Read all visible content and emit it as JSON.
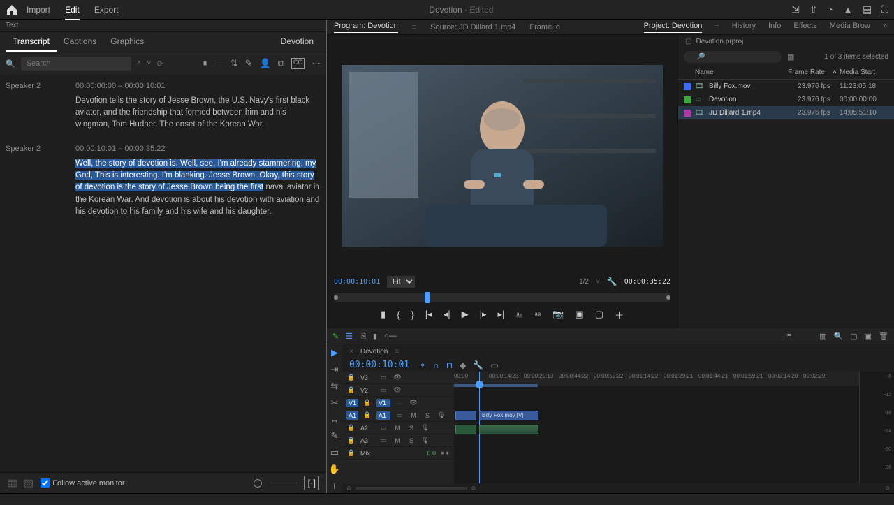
{
  "app": {
    "modes": [
      "Import",
      "Edit",
      "Export"
    ],
    "active_mode": "Edit",
    "title": "Devotion",
    "title_suffix": "Edited"
  },
  "left": {
    "text_tab": "Text",
    "sub_tabs": [
      "Transcript",
      "Captions",
      "Graphics"
    ],
    "active_sub": "Transcript",
    "sequence": "Devotion",
    "search_placeholder": "Search",
    "segments": [
      {
        "speaker": "Speaker 2",
        "tc": "00:00:00:00 – 00:00:10:01",
        "text": "Devotion tells the story of Jesse Brown, the U.S. Navy's first black aviator, and the friendship that formed between him and his wingman, Tom Hudner. The onset of the Korean War."
      },
      {
        "speaker": "Speaker 2",
        "tc": "00:00:10:01 – 00:00:35:22",
        "hl": "Well, the story of devotion is. Well, see, I'm already stammering, my God, This is interesting. I'm blanking. Jesse Brown. Okay,        this story of devotion is the story of Jesse Brown being the first",
        "rest": " naval aviator in the Korean War. And devotion is about his devotion with aviation and his devotion to his family and his wife and his daughter."
      }
    ],
    "follow_label": "Follow active monitor"
  },
  "program": {
    "tabs": {
      "program": "Program: Devotion",
      "source": "Source: JD Dillard 1.mp4",
      "frameio": "Frame.io"
    },
    "tc_in": "00:00:10:01",
    "fit": "Fit",
    "cam": "1/2",
    "tc_out": "00:00:35:22"
  },
  "project": {
    "tab": "Project: Devotion",
    "tabs_other": [
      "History",
      "Info",
      "Effects",
      "Media Brow"
    ],
    "crumb": "Devotion.prproj",
    "selection": "1 of 3 items selected",
    "cols": [
      "Name",
      "Frame Rate",
      "Media Start"
    ],
    "rows": [
      {
        "color": "#3a6aff",
        "name": "Billy Fox.mov",
        "fr": "23.976 fps",
        "ms": "11:23:05:18"
      },
      {
        "color": "#3aaa3a",
        "name": "Devotion",
        "fr": "23.976 fps",
        "ms": "00:00:00:00"
      },
      {
        "color": "#aa3aaa",
        "name": "JD Dillard 1.mp4",
        "fr": "23.976 fps",
        "ms": "14:05:51:10",
        "sel": true
      }
    ]
  },
  "timeline": {
    "name": "Devotion",
    "tc": "00:00:10:01",
    "ruler": [
      "00:00",
      "00:00:14:23",
      "00:00:29:13",
      "00:00:44:22",
      "00:00:59:22",
      "00:01:14:22",
      "00:01:29:21",
      "00:01:44:21",
      "00:01:59:21",
      "00:02:14:20",
      "00:02:29:"
    ],
    "tracks_v": [
      "V3",
      "V2",
      "V1"
    ],
    "tracks_a": [
      "A1",
      "A2",
      "A3"
    ],
    "mix": "Mix",
    "mix_val": "0.0",
    "clip_v": "Billy Fox.mov [V]"
  }
}
